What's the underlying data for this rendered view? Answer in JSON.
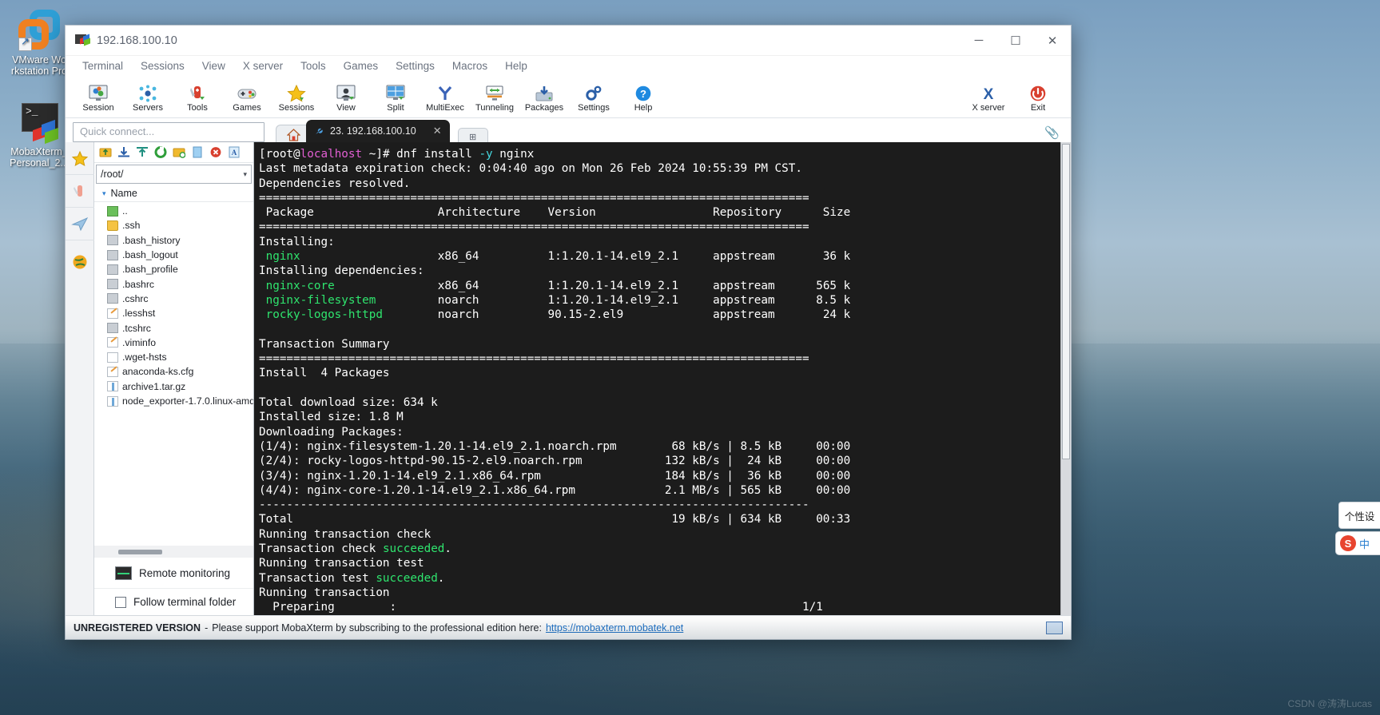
{
  "desktop": {
    "icons": [
      {
        "name": "vmware-workstation",
        "label_line1": "VMware Wo",
        "label_line2": "rkstation Pro"
      },
      {
        "name": "mobaxterm",
        "label_line1": "MobaXterm_",
        "label_line2": "Personal_2..."
      }
    ],
    "watermark": "CSDN @涛涛Lucas"
  },
  "window": {
    "title": "192.168.100.10",
    "minimize": "─",
    "maximize": "☐",
    "close": "✕"
  },
  "menubar": {
    "items": [
      "Terminal",
      "Sessions",
      "View",
      "X server",
      "Tools",
      "Games",
      "Settings",
      "Macros",
      "Help"
    ]
  },
  "toolbar": {
    "items": [
      {
        "label": "Session",
        "icon": "session-icon"
      },
      {
        "label": "Servers",
        "icon": "servers-icon"
      },
      {
        "label": "Tools",
        "icon": "tools-icon"
      },
      {
        "label": "Games",
        "icon": "games-icon"
      },
      {
        "label": "Sessions",
        "icon": "sessions-star-icon"
      },
      {
        "label": "View",
        "icon": "view-icon"
      },
      {
        "label": "Split",
        "icon": "split-icon"
      },
      {
        "label": "MultiExec",
        "icon": "multiexec-icon"
      },
      {
        "label": "Tunneling",
        "icon": "tunneling-icon"
      },
      {
        "label": "Packages",
        "icon": "packages-icon"
      },
      {
        "label": "Settings",
        "icon": "settings-gear-icon"
      },
      {
        "label": "Help",
        "icon": "help-icon"
      }
    ],
    "right_items": [
      {
        "label": "X server",
        "icon": "xserver-icon"
      },
      {
        "label": "Exit",
        "icon": "power-icon"
      }
    ]
  },
  "quick_connect": {
    "placeholder": "Quick connect..."
  },
  "tabs": {
    "home_icon": "home-icon",
    "active": {
      "label": "23. 192.168.100.10",
      "close": "✕",
      "icon": "ssh-wrench-icon"
    },
    "new_tab": "⊞"
  },
  "sftp": {
    "toolbar_icons": [
      "up-one-level-icon",
      "download-icon",
      "upload-icon",
      "refresh-icon",
      "new-folder-icon",
      "new-file-icon",
      "delete-icon",
      "text-mode-icon"
    ],
    "path": "/root/",
    "path_dropdown": "▾",
    "column_header": "Name",
    "sort_arrow": "▾",
    "files": [
      {
        "name": "..",
        "type": "up"
      },
      {
        "name": ".ssh",
        "type": "dir"
      },
      {
        "name": ".bash_history",
        "type": "sh"
      },
      {
        "name": ".bash_logout",
        "type": "sh"
      },
      {
        "name": ".bash_profile",
        "type": "sh"
      },
      {
        "name": ".bashrc",
        "type": "sh"
      },
      {
        "name": ".cshrc",
        "type": "sh"
      },
      {
        "name": ".lesshst",
        "type": "edit"
      },
      {
        "name": ".tcshrc",
        "type": "sh"
      },
      {
        "name": ".viminfo",
        "type": "edit"
      },
      {
        "name": ".wget-hsts",
        "type": "doc"
      },
      {
        "name": "anaconda-ks.cfg",
        "type": "edit"
      },
      {
        "name": "archive1.tar.gz",
        "type": "arch"
      },
      {
        "name": "node_exporter-1.7.0.linux-amd",
        "type": "arch"
      }
    ],
    "remote_monitoring": "Remote monitoring",
    "follow_terminal_folder": "Follow terminal folder"
  },
  "left_rail": {
    "items": [
      {
        "name": "sessions-rail-icon",
        "glyph": "★"
      },
      {
        "name": "tools-rail-icon",
        "glyph": "⚔"
      },
      {
        "name": "macros-rail-icon",
        "glyph": "➤"
      },
      {
        "name": "sftp-rail-icon",
        "glyph": "●"
      }
    ]
  },
  "terminal": {
    "lines": [
      [
        {
          "t": "[root@",
          "c": "w"
        },
        {
          "t": "localhost",
          "c": "m"
        },
        {
          "t": " ~]# dnf install ",
          "c": "w"
        },
        {
          "t": "-y",
          "c": "c"
        },
        {
          "t": " nginx",
          "c": "w"
        }
      ],
      [
        {
          "t": "Last metadata expiration check: 0:04:40 ago on Mon 26 Feb 2024 10:55:39 PM CST.",
          "c": "w"
        }
      ],
      [
        {
          "t": "Dependencies resolved.",
          "c": "w"
        }
      ],
      [
        {
          "t": "================================================================================",
          "c": "w"
        }
      ],
      [
        {
          "t": " Package                  Architecture    Version                 Repository      Size",
          "c": "w"
        }
      ],
      [
        {
          "t": "================================================================================",
          "c": "w"
        }
      ],
      [
        {
          "t": "Installing:",
          "c": "w"
        }
      ],
      [
        {
          "t": " nginx",
          "c": "g"
        },
        {
          "t": "                    x86_64          1:1.20.1-14.el9_2.1     appstream       36 k",
          "c": "w"
        }
      ],
      [
        {
          "t": "Installing dependencies:",
          "c": "w"
        }
      ],
      [
        {
          "t": " nginx-core",
          "c": "g"
        },
        {
          "t": "               x86_64          1:1.20.1-14.el9_2.1     appstream      565 k",
          "c": "w"
        }
      ],
      [
        {
          "t": " nginx-filesystem",
          "c": "g"
        },
        {
          "t": "         noarch          1:1.20.1-14.el9_2.1     appstream      8.5 k",
          "c": "w"
        }
      ],
      [
        {
          "t": " rocky-logos-httpd",
          "c": "g"
        },
        {
          "t": "        noarch          90.15-2.el9             appstream       24 k",
          "c": "w"
        }
      ],
      [
        {
          "t": "",
          "c": "w"
        }
      ],
      [
        {
          "t": "Transaction Summary",
          "c": "w"
        }
      ],
      [
        {
          "t": "================================================================================",
          "c": "w"
        }
      ],
      [
        {
          "t": "Install  4 Packages",
          "c": "w"
        }
      ],
      [
        {
          "t": "",
          "c": "w"
        }
      ],
      [
        {
          "t": "Total download size: 634 k",
          "c": "w"
        }
      ],
      [
        {
          "t": "Installed size: 1.8 M",
          "c": "w"
        }
      ],
      [
        {
          "t": "Downloading Packages:",
          "c": "w"
        }
      ],
      [
        {
          "t": "(1/4): nginx-filesystem-1.20.1-14.el9_2.1.noarch.rpm        68 kB/s | 8.5 kB     00:00",
          "c": "w"
        }
      ],
      [
        {
          "t": "(2/4): rocky-logos-httpd-90.15-2.el9.noarch.rpm            132 kB/s |  24 kB     00:00",
          "c": "w"
        }
      ],
      [
        {
          "t": "(3/4): nginx-1.20.1-14.el9_2.1.x86_64.rpm                  184 kB/s |  36 kB     00:00",
          "c": "w"
        }
      ],
      [
        {
          "t": "(4/4): nginx-core-1.20.1-14.el9_2.1.x86_64.rpm             2.1 MB/s | 565 kB     00:00",
          "c": "w"
        }
      ],
      [
        {
          "t": "--------------------------------------------------------------------------------",
          "c": "w"
        }
      ],
      [
        {
          "t": "Total                                                       19 kB/s | 634 kB     00:33",
          "c": "w"
        }
      ],
      [
        {
          "t": "Running transaction check",
          "c": "w"
        }
      ],
      [
        {
          "t": "Transaction check ",
          "c": "w"
        },
        {
          "t": "succeeded",
          "c": "g"
        },
        {
          "t": ".",
          "c": "w"
        }
      ],
      [
        {
          "t": "Running transaction test",
          "c": "w"
        }
      ],
      [
        {
          "t": "Transaction test ",
          "c": "w"
        },
        {
          "t": "succeeded",
          "c": "g"
        },
        {
          "t": ".",
          "c": "w"
        }
      ],
      [
        {
          "t": "Running transaction",
          "c": "w"
        }
      ],
      [
        {
          "t": "  Preparing        :                                                           1/1",
          "c": "w"
        }
      ]
    ]
  },
  "statusbar": {
    "unregistered": "UNREGISTERED VERSION",
    "dash": "-",
    "message": "Please support MobaXterm by subscribing to the professional edition here:",
    "link": "https://mobaxterm.mobatek.net"
  },
  "ime": {
    "tip": "个性设",
    "logo": "S",
    "mode": "中"
  }
}
